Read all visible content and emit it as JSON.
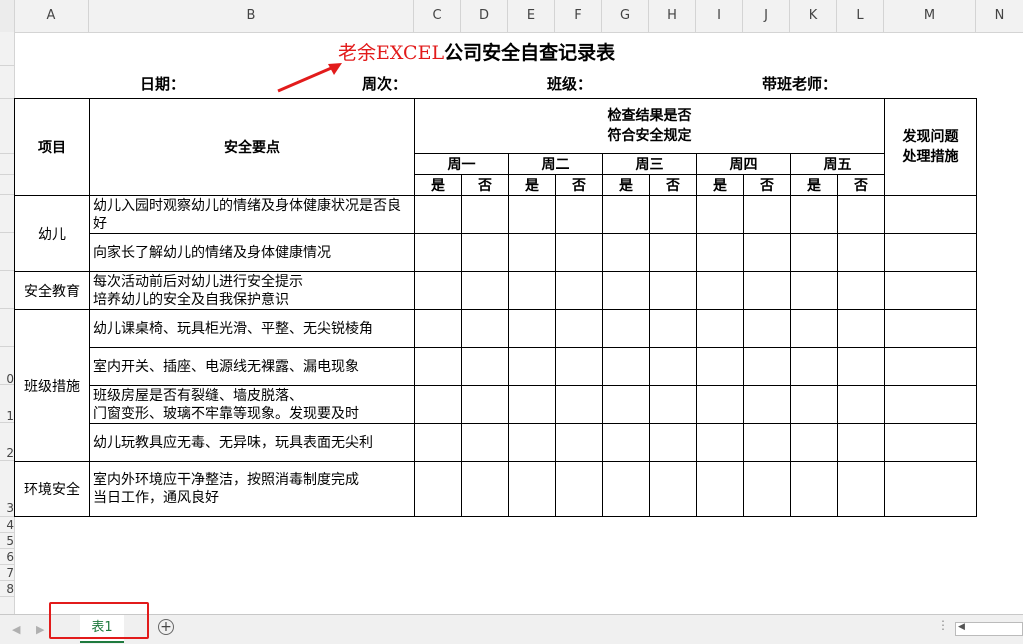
{
  "columns": [
    "A",
    "B",
    "C",
    "D",
    "E",
    "F",
    "G",
    "H",
    "I",
    "J",
    "K",
    "L",
    "M",
    "N"
  ],
  "row_numbers": [
    "0",
    "1",
    "2",
    "3",
    "4",
    "5",
    "6",
    "7",
    "8"
  ],
  "title": {
    "red_part": "老余EXCEL",
    "black_part": "公司安全自查记录表"
  },
  "info": {
    "date": "日期：",
    "week": "周次：",
    "class": "班级：",
    "teacher": "带班老师："
  },
  "headers": {
    "project": "项目",
    "key_points": "安全要点",
    "check_line1": "检查结果是否",
    "check_line2": "符合安全规定",
    "issue_line1": "发现问题",
    "issue_line2": "处理措施",
    "days": [
      "周一",
      "周二",
      "周三",
      "周四",
      "周五"
    ],
    "yes": "是",
    "no": "否"
  },
  "categories": {
    "child": "幼儿",
    "edu": "安全教育",
    "class": "班级措施",
    "env": "环境安全"
  },
  "points": {
    "p1": "幼儿入园时观察幼儿的情绪及身体健康状况是否良好",
    "p2": "向家长了解幼儿的情绪及身体健康情况",
    "p3a": "每次活动前后对幼儿进行安全提示",
    "p3b": "培养幼儿的安全及自我保护意识",
    "p4": "幼儿课桌椅、玩具柜光滑、平整、无尖锐棱角",
    "p5": "室内开关、插座、电源线无裸露、漏电现象",
    "p6a": "班级房屋是否有裂缝、墙皮脱落、",
    "p6b": "门窗变形、玻璃不牢靠等现象。发现要及时",
    "p7": "幼儿玩教具应无毒、无异味，玩具表面无尖利",
    "p8a": "室内外环境应干净整洁，按照消毒制度完成",
    "p8b": "当日工作，通风良好"
  },
  "tabs": {
    "sheet1": "表1",
    "add": "+"
  },
  "colors": {
    "accent_red": "#e21b1b",
    "tab_green": "#1f7a3e"
  }
}
